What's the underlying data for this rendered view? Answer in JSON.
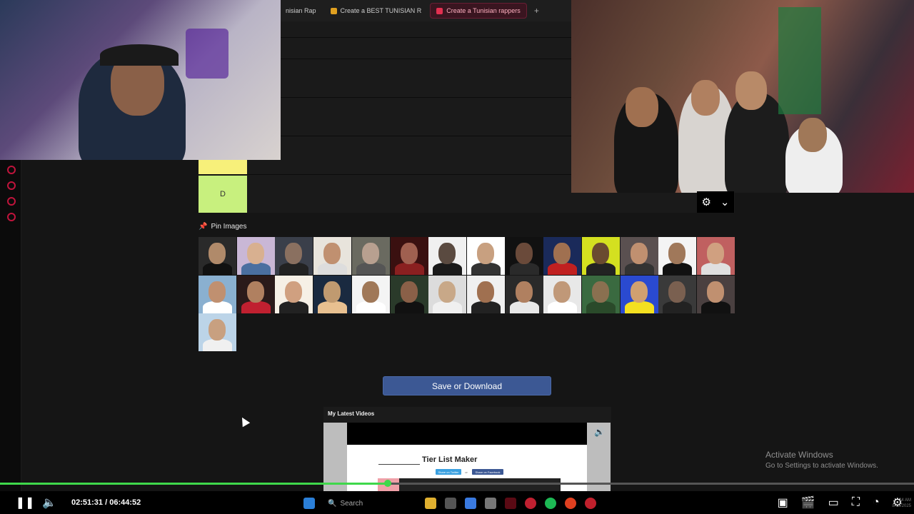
{
  "browser": {
    "tabs": [
      {
        "label": "nisian Rap",
        "active": false
      },
      {
        "label": "Create a BEST TUNISIAN R",
        "active": false
      },
      {
        "label": "Create a Tunisian rappers",
        "active": true
      }
    ],
    "new_tab": "+"
  },
  "tiers": {
    "visible_label": "D",
    "colors": {
      "yellow": "#f7f07a",
      "green": "#c8f07e"
    }
  },
  "pin_images": {
    "label": "Pin Images",
    "icon": "pin-icon",
    "thumbnails": [
      {
        "bg": "#2a2a2a",
        "face": "#b08a6a",
        "body": "#111"
      },
      {
        "bg": "#c9b7d6",
        "face": "#d8b090",
        "body": "#4a6fa0"
      },
      {
        "bg": "#3a3f4a",
        "face": "#8a7060",
        "body": "#222"
      },
      {
        "bg": "#e8e4dc",
        "face": "#c09070",
        "body": "#ddd"
      },
      {
        "bg": "#6a6a60",
        "face": "#b8a090",
        "body": "#555"
      },
      {
        "bg": "#3a1010",
        "face": "#a06050",
        "body": "#8a2020"
      },
      {
        "bg": "#f0f0f0",
        "face": "#5a4a40",
        "body": "#1a1a1a"
      },
      {
        "bg": "#ffffff",
        "face": "#c8a080",
        "body": "#333"
      },
      {
        "bg": "#111111",
        "face": "#6a4a3a",
        "body": "#2a2a2a"
      },
      {
        "bg": "#1a2a5a",
        "face": "#a07050",
        "body": "#c02020"
      },
      {
        "bg": "#d4e020",
        "face": "#6a4a30",
        "body": "#222"
      },
      {
        "bg": "#5a5050",
        "face": "#c09070",
        "body": "#333"
      },
      {
        "bg": "#f4f4f4",
        "face": "#a0785a",
        "body": "#111"
      },
      {
        "bg": "#c06060",
        "face": "#d0a080",
        "body": "#e0e0e0"
      },
      {
        "bg": "#8ab0d0",
        "face": "#c09070",
        "body": "#fff"
      },
      {
        "bg": "#2a1a1a",
        "face": "#b08060",
        "body": "#c02030"
      },
      {
        "bg": "#f6f0e6",
        "face": "#d0a080",
        "body": "#222"
      },
      {
        "bg": "#1a2a40",
        "face": "#c09a70",
        "body": "#e8c090"
      },
      {
        "bg": "#f4f4f4",
        "face": "#a07858",
        "body": "#fff"
      },
      {
        "bg": "#2a3a2a",
        "face": "#8a6048",
        "body": "#111"
      },
      {
        "bg": "#dcdcdc",
        "face": "#c8a888",
        "body": "#f0f0f0"
      },
      {
        "bg": "#f0f0f0",
        "face": "#a07050",
        "body": "#222"
      },
      {
        "bg": "#2a2a2a",
        "face": "#b08060",
        "body": "#e8e8e8"
      },
      {
        "bg": "#e8e8e8",
        "face": "#c09878",
        "body": "#fff"
      },
      {
        "bg": "#3a6a40",
        "face": "#8a7050",
        "body": "#2a4a2a"
      },
      {
        "bg": "#2a4ad0",
        "face": "#d0a070",
        "body": "#f4e020"
      },
      {
        "bg": "#3a3a3a",
        "face": "#7a6050",
        "body": "#222"
      },
      {
        "bg": "#4a4040",
        "face": "#c09070",
        "body": "#111"
      },
      {
        "bg": "#bcd4e8",
        "face": "#c8a080",
        "body": "#f0f0f0"
      }
    ]
  },
  "actions": {
    "save_label": "Save or Download"
  },
  "videos": {
    "title": "My Latest Videos",
    "preview_title": "Tier List Maker",
    "share_twitter": "Share on Twitter",
    "share_or": "or",
    "share_facebook": "Share on Facebook"
  },
  "watermark": {
    "line1": "Activate Windows",
    "line2": "Go to Settings to activate Windows."
  },
  "player": {
    "time_current": "02:51:31",
    "time_separator": " / ",
    "time_total": "06:44:52",
    "progress": 0.4239
  },
  "taskbar": {
    "search_placeholder": "Search"
  },
  "clock": {
    "time": "24 AM",
    "date": "8/15/2025"
  }
}
